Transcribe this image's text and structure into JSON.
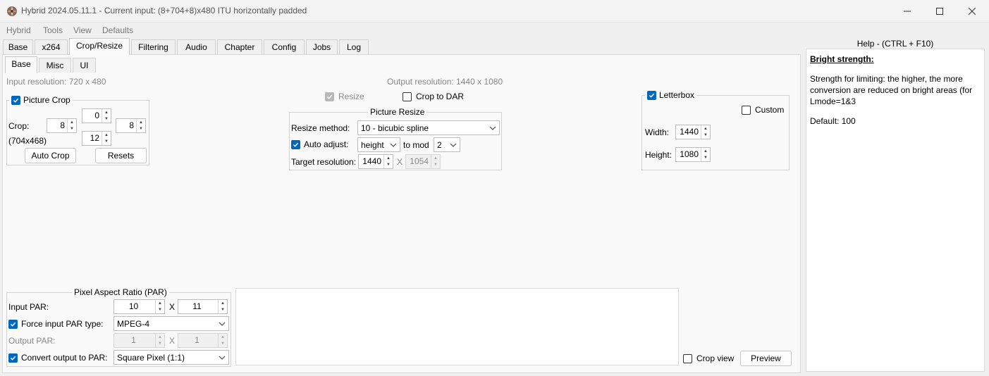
{
  "window": {
    "title": "Hybrid 2024.05.11.1 - Current input: (8+704+8)x480 ITU horizontally padded"
  },
  "menu": [
    "Hybrid",
    "Tools",
    "View",
    "Defaults"
  ],
  "main_tabs": [
    "Base",
    "x264",
    "Crop/Resize",
    "Filtering",
    "Audio",
    "Chapter",
    "Config",
    "Jobs",
    "Log"
  ],
  "active_main_tab": "Crop/Resize",
  "sub_tabs": [
    "Base",
    "Misc",
    "UI"
  ],
  "active_sub_tab": "Base",
  "input_resolution": "Input resolution: 720 x 480",
  "output_resolution": "Output resolution: 1440 x 1080",
  "picture_crop": {
    "label": "Picture Crop",
    "checked": true,
    "crop_label": "Crop:",
    "top": "0",
    "left": "8",
    "right": "8",
    "bottom": "12",
    "dims": "(704x468)",
    "auto_crop": "Auto Crop",
    "resets": "Resets"
  },
  "resize": {
    "resize_label": "Resize",
    "resize_checked": true,
    "crop_to_dar_label": "Crop to DAR",
    "crop_to_dar_checked": false
  },
  "picture_resize": {
    "title": "Picture Resize",
    "method_label": "Resize method:",
    "method_value": "10 - bicubic spline",
    "auto_adjust_label": "Auto adjust:",
    "auto_adjust_checked": true,
    "auto_adjust_value": "height",
    "to_mod_label": "to mod",
    "mod_value": "2",
    "target_label": "Target resolution:",
    "target_width": "1440",
    "x_label": "X",
    "target_height": "1054"
  },
  "letterbox": {
    "label": "Letterbox",
    "checked": true,
    "custom_label": "Custom",
    "custom_checked": false,
    "width_label": "Width:",
    "width_value": "1440",
    "height_label": "Height:",
    "height_value": "1080"
  },
  "par": {
    "title": "Pixel Aspect Ratio (PAR)",
    "input_par_label": "Input PAR:",
    "input_par_a": "10",
    "input_par_b": "11",
    "x_label": "X",
    "force_label": "Force input PAR type:",
    "force_checked": true,
    "force_value": "MPEG-4",
    "output_par_label": "Output PAR:",
    "output_par_a": "1",
    "output_par_b": "1",
    "convert_label": "Convert output to PAR:",
    "convert_checked": true,
    "convert_value": "Square Pixel (1:1)"
  },
  "crop_view_label": "Crop view",
  "crop_view_checked": false,
  "preview_label": "Preview",
  "help": {
    "title": "Help - (CTRL + F10)",
    "heading": "Bright strength:",
    "body": "Strength for limiting: the higher, the more conversion are reduced on bright areas (for Lmode=1&3",
    "default": "Default: 100"
  },
  "colors": {
    "accent": "#0067c0",
    "window_bg": "#f0f0f0",
    "panel_bg": "#f9f9f9"
  }
}
